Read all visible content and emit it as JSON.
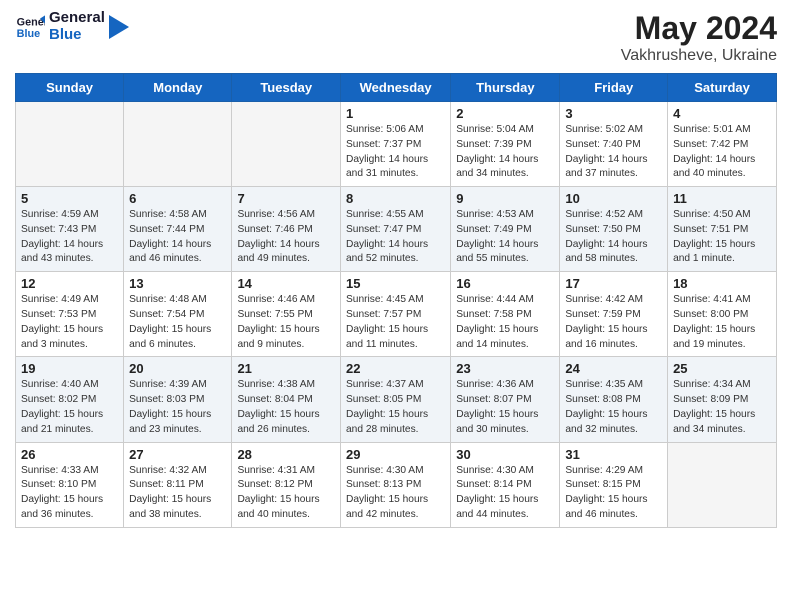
{
  "header": {
    "logo_line1": "General",
    "logo_line2": "Blue",
    "title": "May 2024",
    "subtitle": "Vakhrusheve, Ukraine"
  },
  "days_of_week": [
    "Sunday",
    "Monday",
    "Tuesday",
    "Wednesday",
    "Thursday",
    "Friday",
    "Saturday"
  ],
  "weeks": [
    [
      {
        "day": "",
        "info": ""
      },
      {
        "day": "",
        "info": ""
      },
      {
        "day": "",
        "info": ""
      },
      {
        "day": "1",
        "info": "Sunrise: 5:06 AM\nSunset: 7:37 PM\nDaylight: 14 hours\nand 31 minutes."
      },
      {
        "day": "2",
        "info": "Sunrise: 5:04 AM\nSunset: 7:39 PM\nDaylight: 14 hours\nand 34 minutes."
      },
      {
        "day": "3",
        "info": "Sunrise: 5:02 AM\nSunset: 7:40 PM\nDaylight: 14 hours\nand 37 minutes."
      },
      {
        "day": "4",
        "info": "Sunrise: 5:01 AM\nSunset: 7:42 PM\nDaylight: 14 hours\nand 40 minutes."
      }
    ],
    [
      {
        "day": "5",
        "info": "Sunrise: 4:59 AM\nSunset: 7:43 PM\nDaylight: 14 hours\nand 43 minutes."
      },
      {
        "day": "6",
        "info": "Sunrise: 4:58 AM\nSunset: 7:44 PM\nDaylight: 14 hours\nand 46 minutes."
      },
      {
        "day": "7",
        "info": "Sunrise: 4:56 AM\nSunset: 7:46 PM\nDaylight: 14 hours\nand 49 minutes."
      },
      {
        "day": "8",
        "info": "Sunrise: 4:55 AM\nSunset: 7:47 PM\nDaylight: 14 hours\nand 52 minutes."
      },
      {
        "day": "9",
        "info": "Sunrise: 4:53 AM\nSunset: 7:49 PM\nDaylight: 14 hours\nand 55 minutes."
      },
      {
        "day": "10",
        "info": "Sunrise: 4:52 AM\nSunset: 7:50 PM\nDaylight: 14 hours\nand 58 minutes."
      },
      {
        "day": "11",
        "info": "Sunrise: 4:50 AM\nSunset: 7:51 PM\nDaylight: 15 hours\nand 1 minute."
      }
    ],
    [
      {
        "day": "12",
        "info": "Sunrise: 4:49 AM\nSunset: 7:53 PM\nDaylight: 15 hours\nand 3 minutes."
      },
      {
        "day": "13",
        "info": "Sunrise: 4:48 AM\nSunset: 7:54 PM\nDaylight: 15 hours\nand 6 minutes."
      },
      {
        "day": "14",
        "info": "Sunrise: 4:46 AM\nSunset: 7:55 PM\nDaylight: 15 hours\nand 9 minutes."
      },
      {
        "day": "15",
        "info": "Sunrise: 4:45 AM\nSunset: 7:57 PM\nDaylight: 15 hours\nand 11 minutes."
      },
      {
        "day": "16",
        "info": "Sunrise: 4:44 AM\nSunset: 7:58 PM\nDaylight: 15 hours\nand 14 minutes."
      },
      {
        "day": "17",
        "info": "Sunrise: 4:42 AM\nSunset: 7:59 PM\nDaylight: 15 hours\nand 16 minutes."
      },
      {
        "day": "18",
        "info": "Sunrise: 4:41 AM\nSunset: 8:00 PM\nDaylight: 15 hours\nand 19 minutes."
      }
    ],
    [
      {
        "day": "19",
        "info": "Sunrise: 4:40 AM\nSunset: 8:02 PM\nDaylight: 15 hours\nand 21 minutes."
      },
      {
        "day": "20",
        "info": "Sunrise: 4:39 AM\nSunset: 8:03 PM\nDaylight: 15 hours\nand 23 minutes."
      },
      {
        "day": "21",
        "info": "Sunrise: 4:38 AM\nSunset: 8:04 PM\nDaylight: 15 hours\nand 26 minutes."
      },
      {
        "day": "22",
        "info": "Sunrise: 4:37 AM\nSunset: 8:05 PM\nDaylight: 15 hours\nand 28 minutes."
      },
      {
        "day": "23",
        "info": "Sunrise: 4:36 AM\nSunset: 8:07 PM\nDaylight: 15 hours\nand 30 minutes."
      },
      {
        "day": "24",
        "info": "Sunrise: 4:35 AM\nSunset: 8:08 PM\nDaylight: 15 hours\nand 32 minutes."
      },
      {
        "day": "25",
        "info": "Sunrise: 4:34 AM\nSunset: 8:09 PM\nDaylight: 15 hours\nand 34 minutes."
      }
    ],
    [
      {
        "day": "26",
        "info": "Sunrise: 4:33 AM\nSunset: 8:10 PM\nDaylight: 15 hours\nand 36 minutes."
      },
      {
        "day": "27",
        "info": "Sunrise: 4:32 AM\nSunset: 8:11 PM\nDaylight: 15 hours\nand 38 minutes."
      },
      {
        "day": "28",
        "info": "Sunrise: 4:31 AM\nSunset: 8:12 PM\nDaylight: 15 hours\nand 40 minutes."
      },
      {
        "day": "29",
        "info": "Sunrise: 4:30 AM\nSunset: 8:13 PM\nDaylight: 15 hours\nand 42 minutes."
      },
      {
        "day": "30",
        "info": "Sunrise: 4:30 AM\nSunset: 8:14 PM\nDaylight: 15 hours\nand 44 minutes."
      },
      {
        "day": "31",
        "info": "Sunrise: 4:29 AM\nSunset: 8:15 PM\nDaylight: 15 hours\nand 46 minutes."
      },
      {
        "day": "",
        "info": ""
      }
    ]
  ]
}
